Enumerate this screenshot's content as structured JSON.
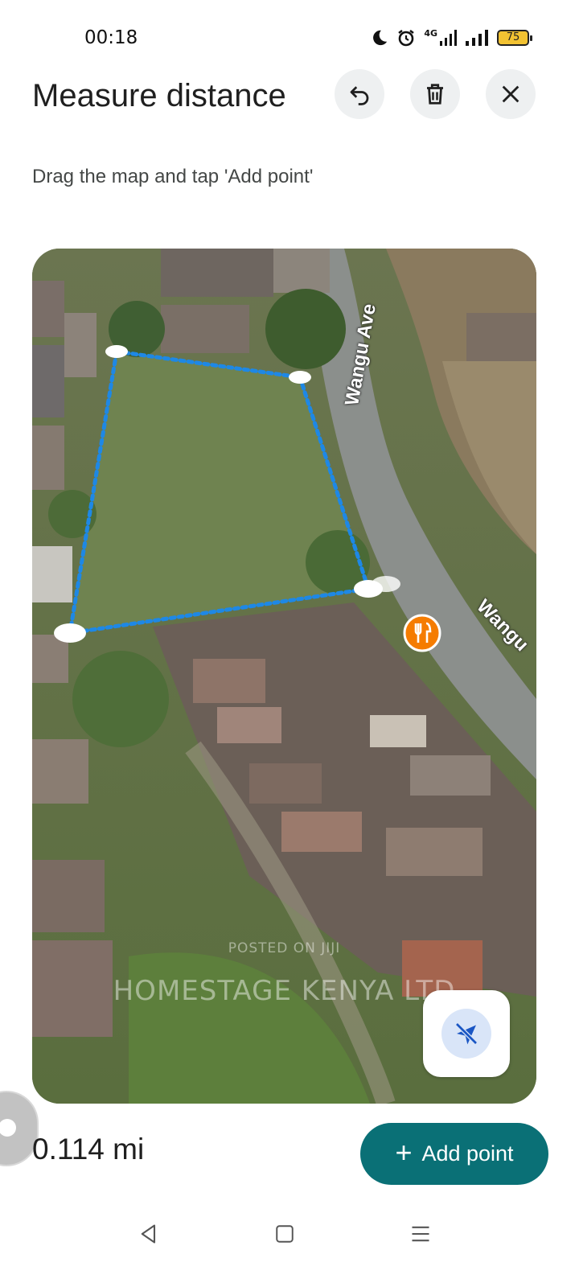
{
  "status_bar": {
    "time": "00:18",
    "network_label": "4G",
    "battery_level": "75",
    "icons": [
      "moon-icon",
      "alarm-icon",
      "signal-4g-icon",
      "signal-icon",
      "battery-icon"
    ]
  },
  "header": {
    "title": "Measure distance",
    "subtitle": "Drag the map and tap 'Add point'",
    "buttons": [
      "undo-icon",
      "delete-icon",
      "close-icon"
    ]
  },
  "map": {
    "road_label_1": "Wangu Ave",
    "road_label_2": "Wangu",
    "watermark_small": "POSTED ON JIJI",
    "watermark_large": "HOMESTAGE KENYA LTD",
    "measure_line_color": "#1e88e5",
    "poi_color": "#f57c00",
    "poi_icon": "restaurant-icon",
    "location_icon": "location-off-icon"
  },
  "footer": {
    "distance": "0.114 mi",
    "add_point_label": "Add point",
    "add_point_icon": "plus-icon",
    "accent_color": "#0a7076"
  },
  "nav_bar": {
    "icons": [
      "back-icon",
      "home-icon",
      "menu-icon"
    ]
  }
}
